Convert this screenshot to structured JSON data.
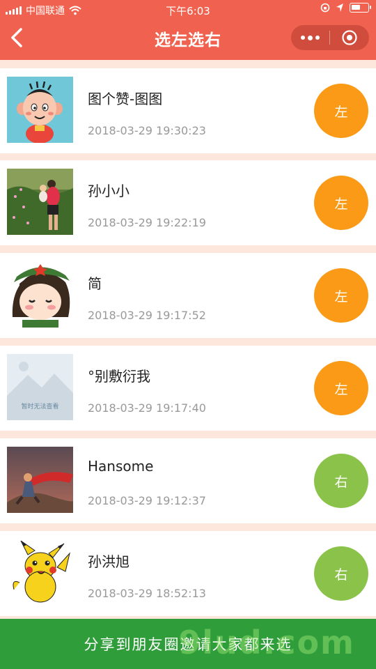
{
  "status": {
    "carrier": "中国联通",
    "time": "下午6:03"
  },
  "nav": {
    "title": "选左选右"
  },
  "items": [
    {
      "name": "图个赞-图图",
      "time": "2018-03-29 19:30:23",
      "choice": "左",
      "choice_color": "#fa9a16",
      "avatar": "cartoon-boy"
    },
    {
      "name": "孙小小",
      "time": "2018-03-29 19:22:19",
      "choice": "左",
      "choice_color": "#fa9a16",
      "avatar": "photo-field"
    },
    {
      "name": "简",
      "time": "2018-03-29 19:17:52",
      "choice": "左",
      "choice_color": "#fa9a16",
      "avatar": "cartoon-soldier-girl"
    },
    {
      "name": "°别敷衍我",
      "time": "2018-03-29 19:17:40",
      "choice": "左",
      "choice_color": "#fa9a16",
      "avatar": "placeholder-image"
    },
    {
      "name": "Hansome",
      "time": "2018-03-29 19:12:37",
      "choice": "右",
      "choice_color": "#8bc34a",
      "avatar": "photo-hero"
    },
    {
      "name": "孙洪旭",
      "time": "2018-03-29 18:52:13",
      "choice": "右",
      "choice_color": "#8bc34a",
      "avatar": "pikachu"
    }
  ],
  "placeholder_caption": "暂时无法查看",
  "footer": {
    "share_label": "分享到朋友圈邀请大家都来选"
  },
  "watermark": "9lud.com"
}
